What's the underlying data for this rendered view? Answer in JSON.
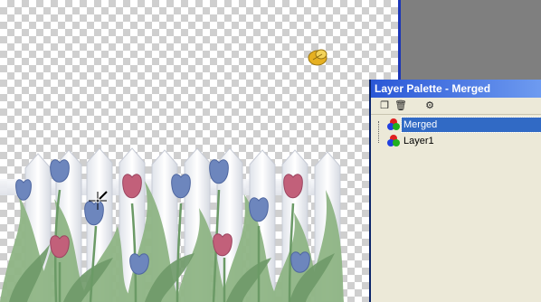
{
  "palette": {
    "title": "Layer Palette - Merged",
    "toolbar": [
      {
        "name": "new-layer-icon",
        "glyph": "❐"
      },
      {
        "name": "delete-layer-icon",
        "glyph": "🗑"
      },
      {
        "name": "layer-effects-icon",
        "glyph": "⚙"
      }
    ],
    "layers": [
      {
        "label": "Merged",
        "selected": true
      },
      {
        "label": "Layer1",
        "selected": false
      }
    ]
  },
  "canvas": {
    "cursor_icon": "eyedropper-icon",
    "tool_icon": "gold-leaf-icon",
    "image_icon": "tulip-fence-image"
  },
  "colors": {
    "selection": "#316ac5",
    "titlebar": "#2a57d6",
    "workspace": "#7f7f7f",
    "tulip_pink": "#c2607a",
    "tulip_blue": "#6d86bd",
    "leaf_green": "#7eaa78",
    "fence_white": "#f3f4f7"
  }
}
